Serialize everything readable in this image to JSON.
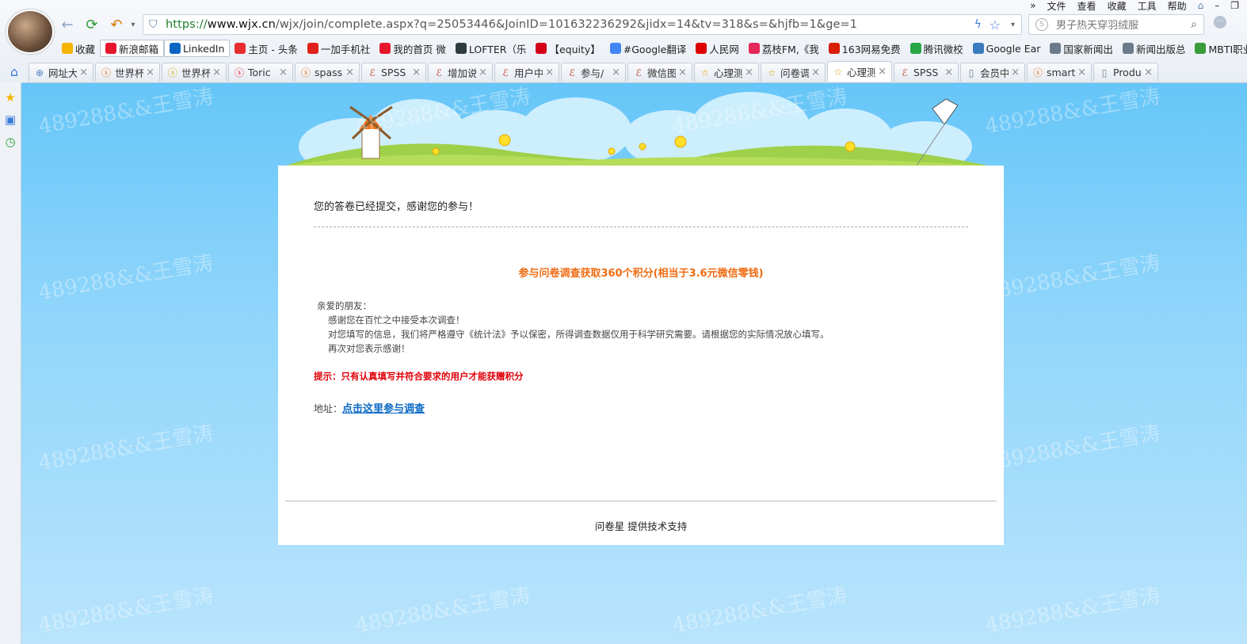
{
  "browser": {
    "menu": [
      "»",
      "文件",
      "查看",
      "收藏",
      "工具",
      "帮助"
    ],
    "url_scheme": "https://",
    "url_host": "www.wjx.cn",
    "url_rest": "/wjx/join/complete.aspx?q=25053446&JoinID=101632236292&jidx=14&tv=318&s=&hjfb=1&ge=1",
    "search_placeholder": "男子热天穿羽绒服",
    "bookmarks": [
      {
        "label": "收藏",
        "icon": "star-icon",
        "color": "#f5b400"
      },
      {
        "label": "新浪邮箱",
        "icon": "weibo-icon",
        "color": "#e6162d"
      },
      {
        "label": "LinkedIn",
        "icon": "linkedin-icon",
        "color": "#0a66c2"
      },
      {
        "label": "主页 - 头条",
        "icon": "toutiao-icon",
        "color": "#e62e2e"
      },
      {
        "label": "一加手机社",
        "icon": "oneplus-icon",
        "color": "#e0201a"
      },
      {
        "label": "我的首页 微",
        "icon": "weibo-icon",
        "color": "#e6162d"
      },
      {
        "label": "LOFTER（乐",
        "icon": "lofter-icon",
        "color": "#2e3c42"
      },
      {
        "label": "【equity】",
        "icon": "y-icon",
        "color": "#d4001a"
      },
      {
        "label": "#Google翻译",
        "icon": "translate-icon",
        "color": "#4285f4"
      },
      {
        "label": "人民网",
        "icon": "people-icon",
        "color": "#d00"
      },
      {
        "label": "荔枝FM,《我",
        "icon": "lizhi-icon",
        "color": "#e5275b"
      },
      {
        "label": "163网易免费",
        "icon": "netease-icon",
        "color": "#d81e06"
      },
      {
        "label": "腾讯微校",
        "icon": "weixiao-icon",
        "color": "#28a745"
      },
      {
        "label": "Google Ear",
        "icon": "earth-icon",
        "color": "#3b7bbf"
      },
      {
        "label": "国家新闻出",
        "icon": "page-icon",
        "color": "#6b7b8c"
      },
      {
        "label": "新闻出版总",
        "icon": "page-icon",
        "color": "#6b7b8c"
      },
      {
        "label": "MBTI职业",
        "icon": "mbti-icon",
        "color": "#3a9b3a"
      }
    ],
    "tabs": [
      {
        "label": "网址大全",
        "icon": "globe-icon",
        "color": "#4a7fc1"
      },
      {
        "label": "世界杯",
        "icon": "sogou-icon",
        "color": "#f06b11"
      },
      {
        "label": "世界杯",
        "icon": "sogou-yellow-icon",
        "color": "#d4a400"
      },
      {
        "label": "Toric",
        "icon": "weibo-icon",
        "color": "#e6162d"
      },
      {
        "label": "spass",
        "icon": "sogou-icon",
        "color": "#f06b11"
      },
      {
        "label": "SPSS",
        "icon": "ie-icon",
        "color": "#c0392b"
      },
      {
        "label": "增加说",
        "icon": "ie-icon",
        "color": "#c0392b"
      },
      {
        "label": "用户中",
        "icon": "ie-icon",
        "color": "#c0392b"
      },
      {
        "label": "参与/",
        "icon": "ie-icon",
        "color": "#c0392b"
      },
      {
        "label": "微信图",
        "icon": "ie-icon",
        "color": "#c0392b"
      },
      {
        "label": "心理测",
        "icon": "star-outline-icon",
        "color": "#e0a000"
      },
      {
        "label": "问卷调",
        "icon": "star-outline-icon",
        "color": "#e0a000"
      },
      {
        "label": "心理测",
        "icon": "star-outline-icon",
        "color": "#e0a000",
        "active": true
      },
      {
        "label": "SPSS",
        "icon": "ie-icon",
        "color": "#c0392b"
      },
      {
        "label": "会员中",
        "icon": "page-icon",
        "color": "#6b7b8c"
      },
      {
        "label": "smart",
        "icon": "sogou-icon",
        "color": "#f06b11"
      },
      {
        "label": "Produ",
        "icon": "page-icon",
        "color": "#6b7b8c"
      }
    ]
  },
  "watermark": "489288&&王雪涛",
  "page": {
    "submitted": "您的答卷已经提交，感谢您的参与！",
    "promo": "参与问卷调查获取360个积分(相当于3.6元微信零钱)",
    "greeting": "亲爱的朋友：",
    "line1": "感谢您在百忙之中接受本次调查！",
    "line2": "对您填写的信息，我们将严格遵守《统计法》予以保密，所得调查数据仅用于科学研究需要。请根据您的实际情况放心填写。",
    "line3": "再次对您表示感谢！",
    "tip": "提示：只有认真填写并符合要求的用户才能获赠积分",
    "addr_label": "地址：",
    "addr_link": "点击这里参与调查",
    "footer": "问卷星 提供技术支持"
  }
}
